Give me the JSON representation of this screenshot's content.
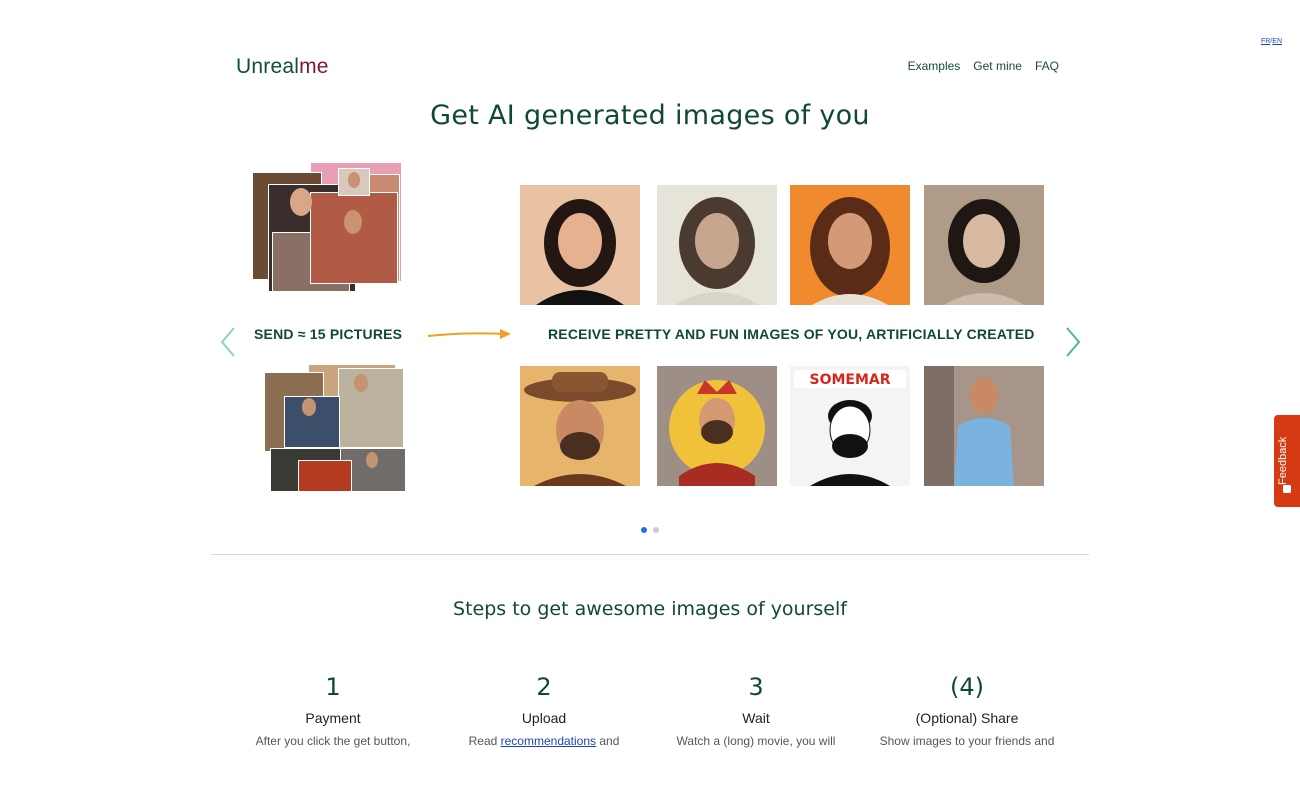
{
  "lang": {
    "fr": "FR",
    "sep": "/",
    "en": "EN"
  },
  "logo": {
    "part1": "Unreal",
    "part2": "me"
  },
  "nav": {
    "examples": "Examples",
    "get_mine": "Get mine",
    "faq": "FAQ"
  },
  "hero": {
    "title": "Get AI generated images of you",
    "send_label": "SEND ≈ 15 PICTURES",
    "receive_label": "RECEIVE PRETTY AND FUN IMAGES OF YOU, ARTIFICIALLY CREATED"
  },
  "carousel": {
    "slide_count": 2,
    "active_index": 0
  },
  "steps": {
    "title": "Steps to get awesome images of yourself",
    "items": [
      {
        "num": "1",
        "name": "Payment",
        "desc": "After you click the get button,"
      },
      {
        "num": "2",
        "name": "Upload",
        "desc_prefix": "Read ",
        "link": "recommendations",
        "desc_suffix": " and"
      },
      {
        "num": "3",
        "name": "Wait",
        "desc": "Watch a (long) movie, you will"
      },
      {
        "num": "(4)",
        "name": "(Optional) Share",
        "desc": "Show images to your friends and"
      }
    ]
  },
  "feedback": {
    "label": "Feedback"
  },
  "colors": {
    "brand_green": "#0f4a30",
    "brand_red": "#7a1a2d",
    "accent_orange": "#f0a020",
    "feedback": "#d63a12",
    "dot_active": "#1a73e8"
  }
}
